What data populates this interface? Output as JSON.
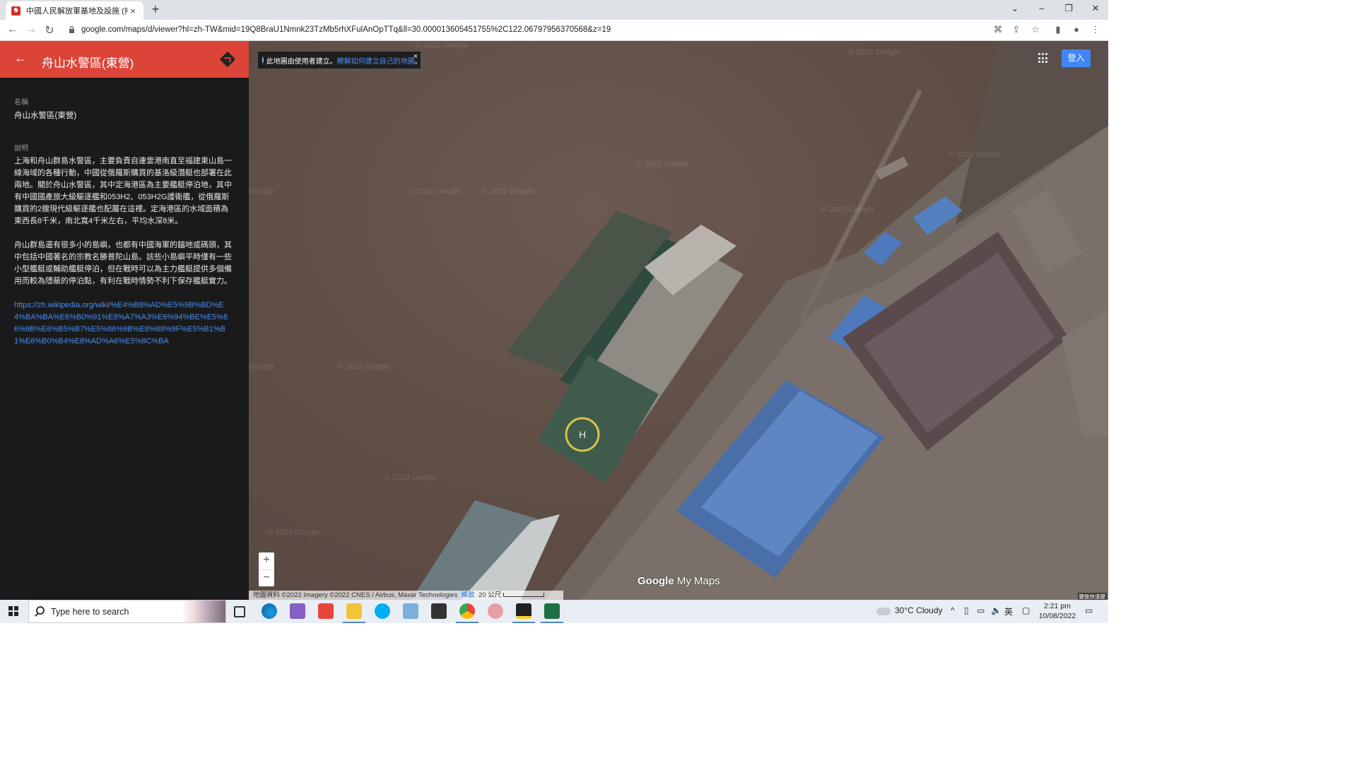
{
  "browser": {
    "tab_title": "中國人民解放軍基地及設施 (持續...",
    "tab_close": "×",
    "new_tab": "+",
    "url": "google.com/maps/d/viewer?hl=zh-TW&mid=19Q8BraU1Nmnk23TzMb5rhXFulAnOpTTq&ll=30.000013605451755%2C122.06797956370568&z=19",
    "nav": {
      "back": "←",
      "forward": "→",
      "reload": "↻"
    },
    "window": {
      "dropdown": "⌄",
      "minimize": "–",
      "restore": "❐",
      "close": "✕"
    },
    "toolbar": {
      "translate": "⌘",
      "share": "⇪",
      "bookmark": "☆",
      "sidepanel": "▮",
      "profile": "●",
      "menu": "⋮"
    }
  },
  "sidebar": {
    "back": "←",
    "title": "舟山水警區(東營)",
    "name_label": "名稱",
    "name_value": "舟山水警區(東營)",
    "desc_label": "說明",
    "desc_p1": "上海和舟山群島水警區，主要負責自連雲港南直至福建東山島一線海域的各種行動，中國從俄羅斯購買的基洛級潛艇也部署在此兩地。關於舟山水警區，其中定海港區為主要艦艇停泊地，其中有中國國產旅大級驅逐艦和053H2、053H2G護衛艦，從俄羅斯購買的2艘現代級驅逐艦也配屬在這裡。定海港區的水域面積為東西長8千米，南北寬4千米左右，平均水深8米。",
    "desc_p2": "舟山群島還有很多小的島嶼，也都有中國海軍的錨地或碼頭，其中包括中國著名的宗教名勝普陀山島。該些小島嶼平時僅有一些小型艦艇或輔助艦艇停泊，但在戰時可以為主力艦艇提供多個備用而較為隱蔽的停泊點，有利在戰時情勢不利下保存艦艇實力。",
    "link": "https://zh.wikipedia.org/wiki/%E4%B8%AD%E5%9B%BD%E4%BA%BA%E6%B0%91%E8%A7%A3%E6%94%BE%E5%86%9B%E6%B5%B7%E5%86%9B%E8%88%9F%E5%B1%B1%E6%B0%B4%E8%AD%A6%E5%8C%BA"
  },
  "map": {
    "info_text": "此地圖由使用者建立。",
    "info_link": "瞭解如何建立自己的地圖",
    "info_end": "。",
    "info_close": "×",
    "login": "登入",
    "zoom_in": "+",
    "zoom_out": "−",
    "attribution": "地圖資料 ©2022 Imagery ©2022 CNES / Airbus, Maxar Technologies",
    "terms": "條款",
    "scale": "20 公尺",
    "logo_google": "Google",
    "logo_mymaps": "My Maps",
    "shortcuts": "鍵盤快速鍵",
    "watermark": "© 2022 Google",
    "watermark_short": "Google"
  },
  "taskbar": {
    "search_placeholder": "Type here to search",
    "weather": "30°C  Cloudy",
    "ime": "英",
    "time": "2:21 pm",
    "date": "10/08/2022"
  },
  "colors": {
    "header_red": "#db4437",
    "link_blue": "#4a8ff2",
    "login_blue": "#4285f4",
    "sidebar_bg": "#1a1a1a"
  }
}
